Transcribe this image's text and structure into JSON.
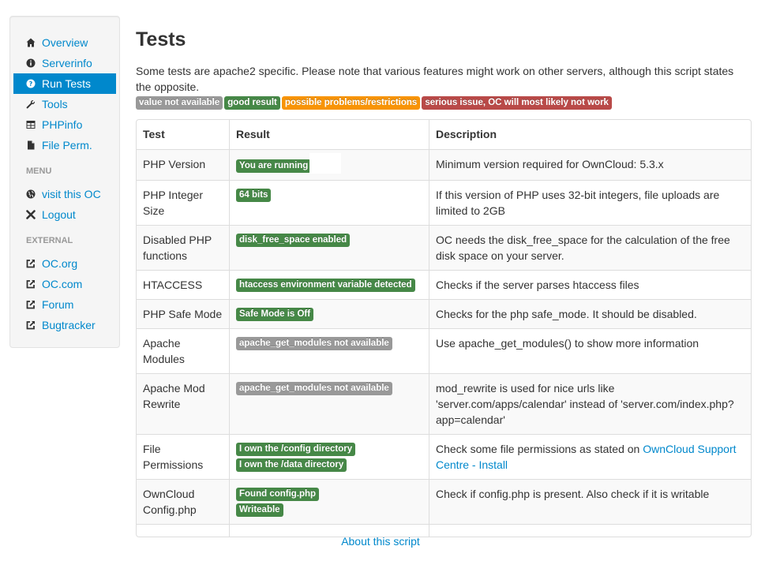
{
  "sidebar": {
    "nav_items": [
      {
        "label": "Overview",
        "icon": "home-icon"
      },
      {
        "label": "Serverinfo",
        "icon": "info-icon"
      },
      {
        "label": "Run Tests",
        "icon": "question-icon",
        "active": true
      },
      {
        "label": "Tools",
        "icon": "wrench-icon"
      },
      {
        "label": "PHPinfo",
        "icon": "table-icon"
      },
      {
        "label": "File Perm.",
        "icon": "file-icon"
      }
    ],
    "menu_header": "MENU",
    "menu_items": [
      {
        "label": "visit this OC",
        "icon": "globe-icon"
      },
      {
        "label": "Logout",
        "icon": "x-icon"
      }
    ],
    "external_header": "EXTERNAL",
    "external_items": [
      {
        "label": "OC.org",
        "icon": "share-icon"
      },
      {
        "label": "OC.com",
        "icon": "share-icon"
      },
      {
        "label": "Forum",
        "icon": "share-icon"
      },
      {
        "label": "Bugtracker",
        "icon": "share-icon"
      }
    ]
  },
  "main": {
    "title": "Tests",
    "intro": "Some tests are apache2 specific. Please note that various features might work on other servers, although this script states the opposite.",
    "legend": [
      {
        "text": "value not available",
        "color": "#999999"
      },
      {
        "text": "good result",
        "color": "#468847"
      },
      {
        "text": "possible problems/restrictions",
        "color": "#f89406"
      },
      {
        "text": "serious issue, OC will most likely not work",
        "color": "#b94a48"
      }
    ],
    "table": {
      "headers": [
        "Test",
        "Result",
        "Description"
      ],
      "rows": [
        {
          "test": "PHP Version",
          "results": [
            {
              "text": "You are running",
              "status": "green"
            }
          ],
          "description": "Minimum version required for OwnCloud: 5.3.x"
        },
        {
          "test": "PHP Integer Size",
          "results": [
            {
              "text": "64 bits",
              "status": "green"
            }
          ],
          "description": "If this version of PHP uses 32-bit integers, file uploads are limited to 2GB"
        },
        {
          "test": "Disabled PHP functions",
          "results": [
            {
              "text": "disk_free_space enabled",
              "status": "green"
            }
          ],
          "description": "OC needs the disk_free_space for the calculation of the free disk space on your server."
        },
        {
          "test": "HTACCESS",
          "results": [
            {
              "text": "htaccess environment variable detected",
              "status": "green"
            }
          ],
          "description": "Checks if the server parses htaccess files"
        },
        {
          "test": "PHP Safe Mode",
          "results": [
            {
              "text": "Safe Mode is Off",
              "status": "green"
            }
          ],
          "description": "Checks for the php safe_mode. It should be disabled."
        },
        {
          "test": "Apache Modules",
          "results": [
            {
              "text": "apache_get_modules not available",
              "status": "grey"
            }
          ],
          "description": "Use apache_get_modules() to show more information"
        },
        {
          "test": "Apache Mod Rewrite",
          "results": [
            {
              "text": "apache_get_modules not available",
              "status": "grey"
            }
          ],
          "description": "mod_rewrite is used for nice urls like 'server.com/apps/calendar' instead of 'server.com/index.php?app=calendar'"
        },
        {
          "test": "File Permissions",
          "results": [
            {
              "text": "I own the /config directory",
              "status": "green"
            },
            {
              "text": "I own the /data directory",
              "status": "green"
            }
          ],
          "description": "Check some file permissions as stated on ",
          "description_link": "OwnCloud Support Centre - Install"
        },
        {
          "test": "OwnCloud Config.php",
          "results": [
            {
              "text": "Found config.php",
              "status": "green"
            },
            {
              "text": "Writeable",
              "status": "green"
            }
          ],
          "description": "Check if config.php is present. Also check if it is writable"
        }
      ]
    }
  },
  "footer": {
    "link": "About this script"
  }
}
